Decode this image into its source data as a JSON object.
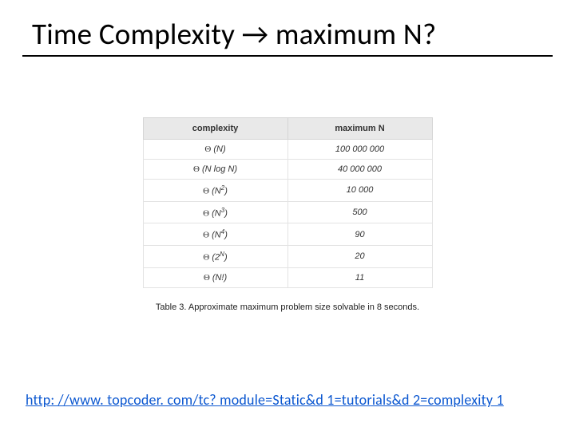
{
  "title": "Time Complexity → maximum N?",
  "table": {
    "headers": {
      "c1": "complexity",
      "c2": "maximum N"
    },
    "rows": [
      {
        "cx_symbol": "Θ",
        "cx_open": "(",
        "cx_base": "N",
        "cx_exp": "",
        "cx_tail": ")",
        "n": "100 000 000"
      },
      {
        "cx_symbol": "Θ",
        "cx_open": "(",
        "cx_base": "N log N",
        "cx_exp": "",
        "cx_tail": ")",
        "n": "40 000 000"
      },
      {
        "cx_symbol": "Θ",
        "cx_open": "(",
        "cx_base": "N",
        "cx_exp": "2",
        "cx_tail": ")",
        "n": "10 000"
      },
      {
        "cx_symbol": "Θ",
        "cx_open": "(",
        "cx_base": "N",
        "cx_exp": "3",
        "cx_tail": ")",
        "n": "500"
      },
      {
        "cx_symbol": "Θ",
        "cx_open": "(",
        "cx_base": "N",
        "cx_exp": "4",
        "cx_tail": ")",
        "n": "90"
      },
      {
        "cx_symbol": "Θ",
        "cx_open": "(",
        "cx_base": "2",
        "cx_exp": "N",
        "cx_tail": ")",
        "n": "20"
      },
      {
        "cx_symbol": "Θ",
        "cx_open": "(",
        "cx_base": "N!",
        "cx_exp": "",
        "cx_tail": ")",
        "n": "11"
      }
    ]
  },
  "caption": "Table 3. Approximate maximum problem size solvable in 8 seconds.",
  "link": {
    "text": "http: //www. topcoder. com/tc? module=Static&d 1=tutorials&d 2=complexity 1",
    "href": "http://www.topcoder.com/tc?module=Static&d1=tutorials&d2=complexity1"
  }
}
